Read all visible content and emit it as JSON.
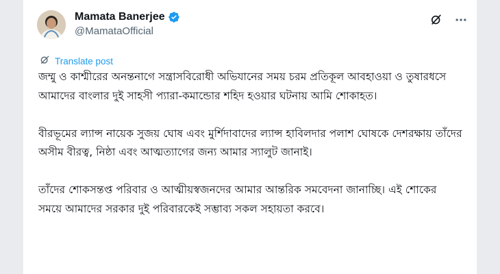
{
  "post": {
    "author": {
      "display_name": "Mamata Banerjee",
      "handle": "@MamataOfficial",
      "verified": true
    },
    "translate_label": "Translate post",
    "paragraphs": [
      "জম্মু ও কাশ্মীরের অনন্তনাগে সন্ত্রাসবিরোধী অভিযানের সময় চরম প্রতিকূল আবহাওয়া ও তুষারধসে আমাদের বাংলার দুই সাহসী প্যারা-কমান্ডোর শহিদ হওয়ার ঘটনায় আমি শোকাহত।",
      "বীরভূমের ল্যান্স নায়েক সুজয় ঘোষ এবং মুর্শিদাবাদের ল্যান্স হাবিলদার পলাশ ঘোষকে দেশরক্ষায় তাঁদের অসীম বীরত্ব, নিষ্ঠা এবং আত্মত্যাগের জন্য আমার স্যালুট জানাই।",
      "তাঁদের শোকসন্তপ্ত পরিবার ও আত্মীয়স্বজনদের আমার আন্তরিক সমবেদনা জানাচ্ছি। এই শোকের সময়ে আমাদের সরকার দুই পরিবারকেই সম্ভাব্য সকল সহায়তা করবে।"
    ]
  },
  "icons": {
    "verified": "verified-badge-icon",
    "grok": "grok-icon",
    "more": "more-options-icon",
    "translate": "translate-icon"
  },
  "colors": {
    "accent": "#1d9bf0",
    "text": "#0f1419",
    "secondary": "#536471"
  }
}
